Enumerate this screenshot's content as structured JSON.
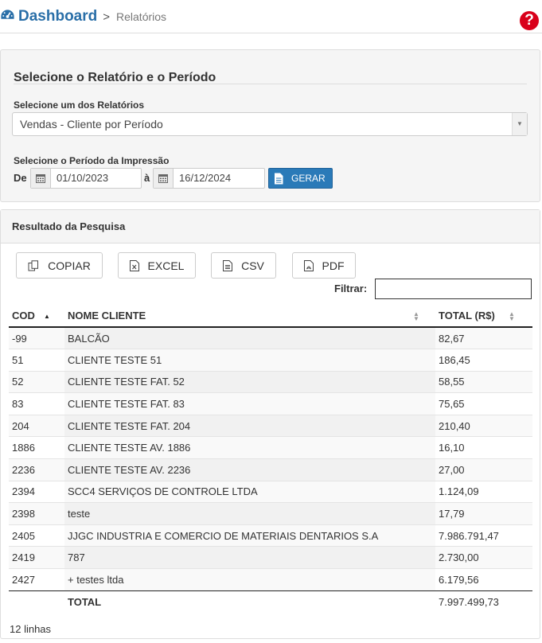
{
  "header": {
    "crumb_main": "Dashboard",
    "crumb_sep": ">",
    "crumb_sub": "Relatórios",
    "help_glyph": "?"
  },
  "form": {
    "title": "Selecione o Relatório e o Período",
    "report_label": "Selecione um dos Relatórios",
    "report_value": "Vendas - Cliente por Período",
    "period_label": "Selecione o Período da Impressão",
    "from_label": "De",
    "from_date": "01/10/2023",
    "to_label": "à",
    "to_date": "16/12/2024",
    "generate_label": "GERAR"
  },
  "results": {
    "title": "Resultado da Pesquisa",
    "buttons": [
      "COPIAR",
      "EXCEL",
      "CSV",
      "PDF"
    ],
    "filter_label": "Filtrar:",
    "filter_value": "",
    "columns": [
      "COD",
      "NOME CLIENTE",
      "TOTAL (R$)"
    ],
    "rows": [
      [
        "-99",
        "BALCÃO",
        "82,67"
      ],
      [
        "51",
        "CLIENTE TESTE 51",
        "186,45"
      ],
      [
        "52",
        "CLIENTE TESTE FAT. 52",
        "58,55"
      ],
      [
        "83",
        "CLIENTE TESTE FAT. 83",
        "75,65"
      ],
      [
        "204",
        "CLIENTE TESTE FAT. 204",
        "210,40"
      ],
      [
        "1886",
        "CLIENTE TESTE AV. 1886",
        "16,10"
      ],
      [
        "2236",
        "CLIENTE TESTE AV. 2236",
        "27,00"
      ],
      [
        "2394",
        "SCC4 SERVIÇOS DE CONTROLE LTDA",
        "1.124,09"
      ],
      [
        "2398",
        "teste",
        "17,79"
      ],
      [
        "2405",
        "JJGC INDUSTRIA E COMERCIO DE MATERIAIS DENTARIOS S.A",
        "7.986.791,47"
      ],
      [
        "2419",
        "787",
        "2.730,00"
      ],
      [
        "2427",
        "+ testes ltda",
        "6.179,56"
      ]
    ],
    "total_label": "TOTAL",
    "total_value": "7.997.499,73",
    "row_count": "12 linhas"
  },
  "colors": {
    "brand": "#2a6fa8",
    "button_primary": "#2a7ab8",
    "help": "#d9001b"
  }
}
